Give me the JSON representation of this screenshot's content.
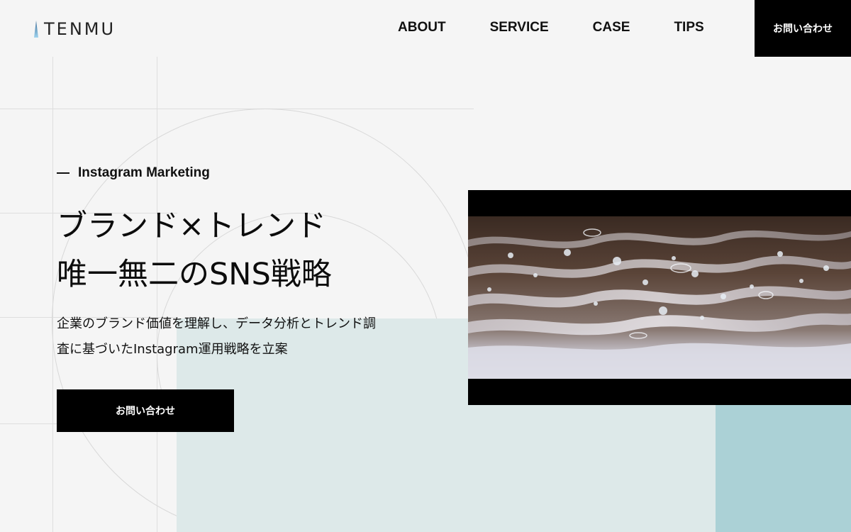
{
  "header": {
    "logo_text": "TENMU",
    "nav": [
      {
        "label": "ABOUT"
      },
      {
        "label": "SERVICE"
      },
      {
        "label": "CASE"
      },
      {
        "label": "TIPS"
      }
    ],
    "contact_label": "お問い合わせ"
  },
  "hero": {
    "eyebrow": "Instagram Marketing",
    "headline_line1": "ブランド×トレンド",
    "headline_line2": "唯一無二のSNS戦略",
    "lead_line1": "企業のブランド価値を理解し、データ分析とトレンド調",
    "lead_line2": "査に基づいたInstagram運用戦略を立案",
    "cta_label": "お問い合わせ"
  },
  "colors": {
    "cta_background": "#000000",
    "accent_pale": "#dde9e9",
    "accent_teal": "#abd1d6",
    "logo_mark": "#7fb6d8"
  }
}
